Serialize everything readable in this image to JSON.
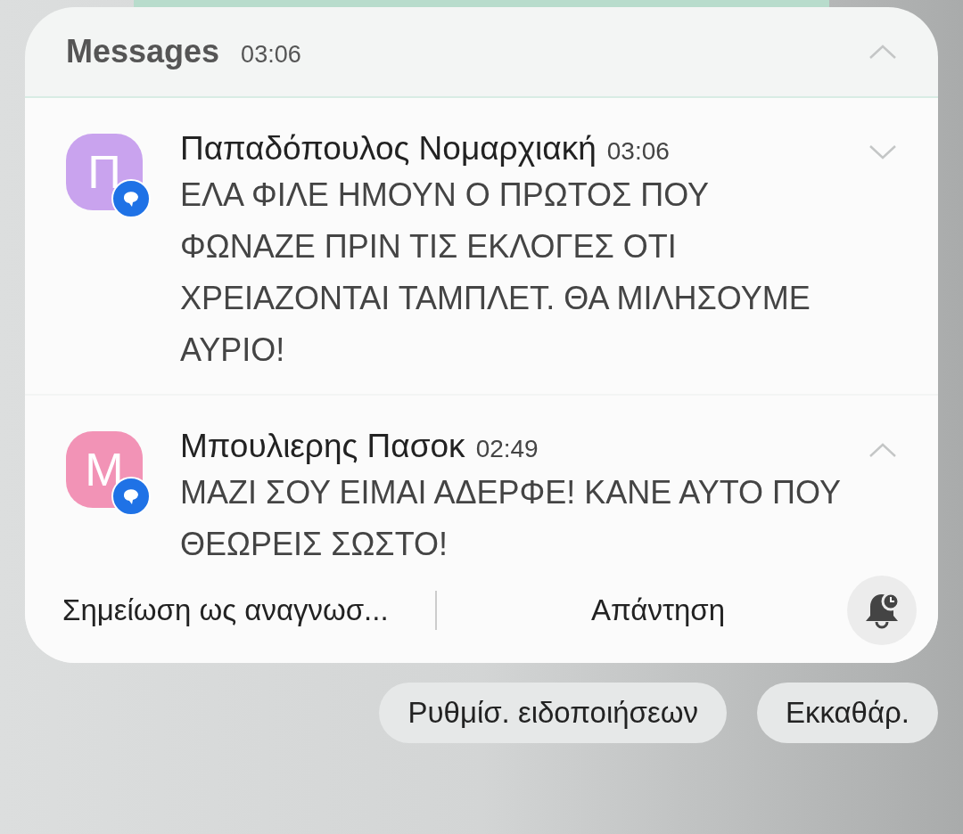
{
  "group": {
    "app": "Messages",
    "time": "03:06",
    "expanded": true
  },
  "notifications": [
    {
      "avatar": "Π",
      "color": "#c9a3ee",
      "sender": "Παπαδόπουλος Νομαρχιακή",
      "time": "03:06",
      "message": "ΕΛΑ ΦΙΛΕ ΗΜΟΥΝ Ο ΠΡΩΤΟΣ ΠΟΥ ΦΩΝΑΖΕ ΠΡΙΝ ΤΙΣ ΕΚΛΟΓΕΣ ΟΤΙ ΧΡΕΙΑΖΟΝΤΑΙ ΤΑΜΠΛΕΤ. ΘΑ ΜΙΛΗΣΟΥΜΕ ΑΥΡΙΟ!",
      "expanded": false
    },
    {
      "avatar": "Μ",
      "color": "#f293b6",
      "sender": "Μπουλιερης Πασοκ",
      "time": "02:49",
      "message": "ΜΑΖΙ ΣΟΥ ΕΙΜΑΙ ΑΔΕΡΦΕ! ΚΑΝΕ ΑΥΤΟ ΠΟΥ ΘΕΩΡΕΙΣ ΣΩΣΤΟ!",
      "expanded": true,
      "actions": [
        "Σημείωση ως αναγνωσ...",
        "Απάντηση"
      ]
    }
  ],
  "footer_buttons": [
    "Ρυθμίσ. ειδοποιήσεων",
    "Εκκαθάρ."
  ]
}
